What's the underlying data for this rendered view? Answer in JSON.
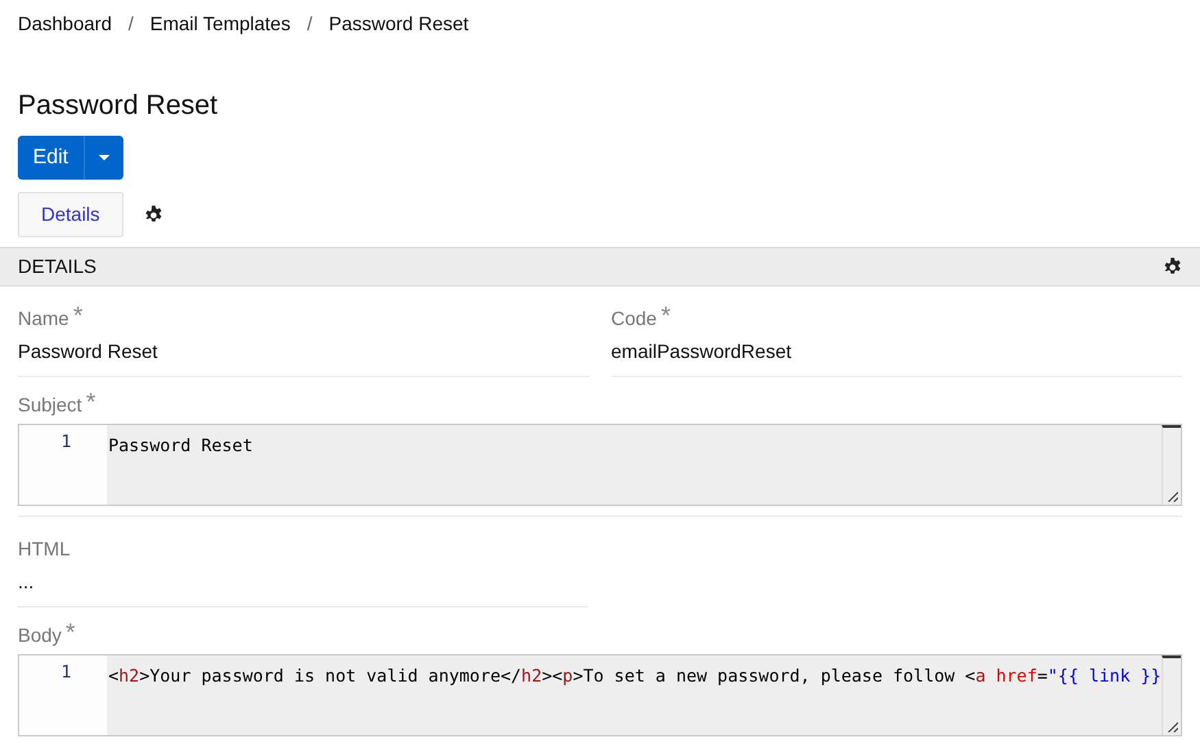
{
  "breadcrumb": [
    {
      "label": "Dashboard"
    },
    {
      "separator": "/",
      "label": "Email Templates"
    },
    {
      "separator": "/",
      "label": "Password Reset"
    }
  ],
  "title": "Password Reset",
  "edit_button": {
    "label": "Edit"
  },
  "tabs": [
    {
      "label": "Details",
      "selected": true
    }
  ],
  "section": {
    "title": "DETAILS"
  },
  "fields": [
    {
      "label": "Name",
      "required_mark": "*",
      "value": "Password Reset"
    },
    {
      "label": "Code",
      "required_mark": "*",
      "value": "emailPasswordReset"
    }
  ],
  "subject": {
    "label": "Subject",
    "required_mark": "*",
    "line_number": "1",
    "tokens": [
      {
        "kind": "text",
        "text": "Password Reset"
      }
    ]
  },
  "html": {
    "label": "HTML",
    "value": "..."
  },
  "body": {
    "label": "Body",
    "required_mark": "*",
    "line_number": "1",
    "tokens": [
      {
        "kind": "text",
        "text": "<"
      },
      {
        "kind": "tag",
        "text": "h2"
      },
      {
        "kind": "text",
        "text": ">Your password is not valid anymore</"
      },
      {
        "kind": "tag",
        "text": "h2"
      },
      {
        "kind": "text",
        "text": "><"
      },
      {
        "kind": "tag",
        "text": "p"
      },
      {
        "kind": "text",
        "text": ">To set a new password, please follow <"
      },
      {
        "kind": "tag",
        "text": "a"
      },
      {
        "kind": "attr",
        "text": " href"
      },
      {
        "kind": "text",
        "text": "="
      },
      {
        "kind": "string",
        "text": "\"{{ link }}"
      }
    ]
  }
}
